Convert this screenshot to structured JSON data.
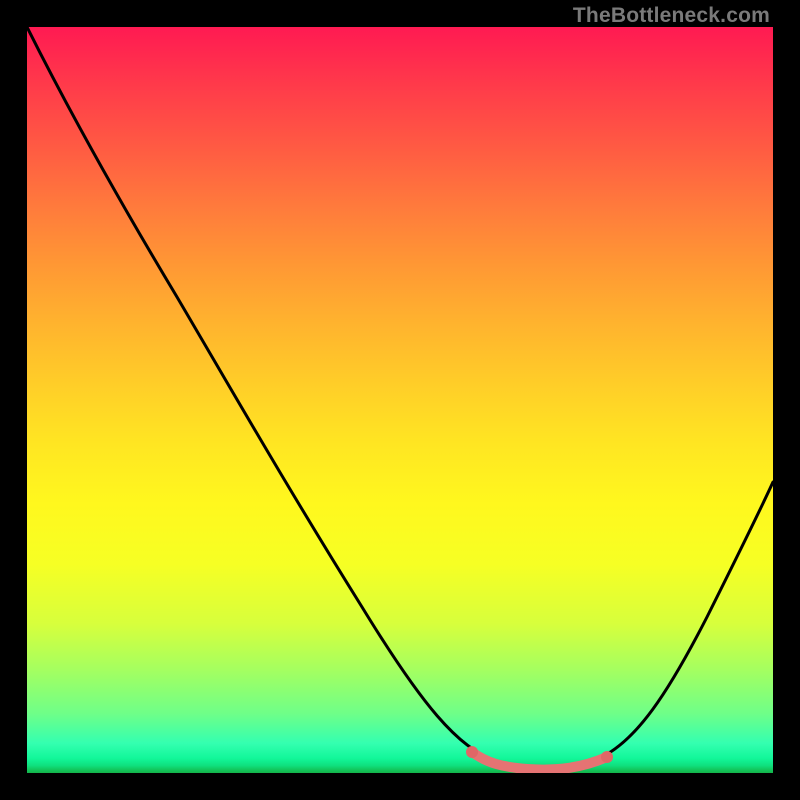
{
  "watermark": "TheBottleneck.com",
  "chart_data": {
    "type": "line",
    "title": "",
    "xlabel": "",
    "ylabel": "",
    "xlim": [
      0,
      100
    ],
    "ylim": [
      0,
      100
    ],
    "series": [
      {
        "name": "bottleneck-curve",
        "x": [
          0,
          10,
          20,
          30,
          40,
          50,
          58,
          62,
          68,
          74,
          78,
          86,
          94,
          100
        ],
        "values": [
          100,
          86,
          72,
          57,
          42,
          27,
          13,
          5,
          1,
          1,
          4,
          16,
          30,
          41
        ]
      }
    ],
    "optimal_range": {
      "x_start": 62,
      "x_end": 78,
      "value": 1
    },
    "gradient_stops": [
      {
        "pos": 0,
        "color": "#ff1a52"
      },
      {
        "pos": 50,
        "color": "#ffe622"
      },
      {
        "pos": 100,
        "color": "#14b34a"
      }
    ]
  }
}
